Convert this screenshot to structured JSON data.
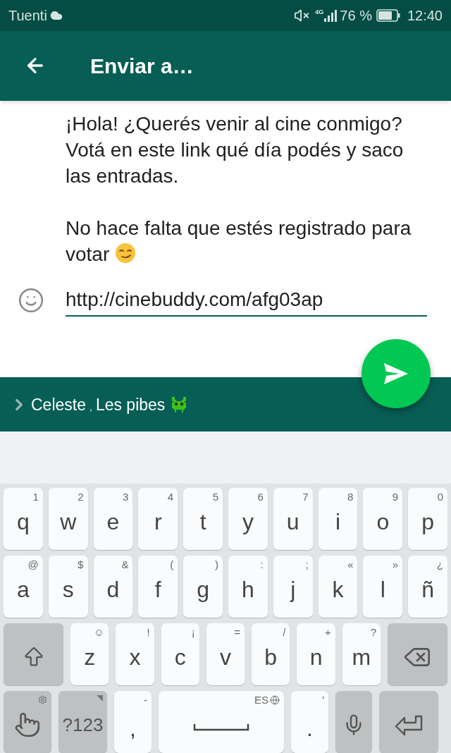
{
  "status_bar": {
    "carrier": "Tuenti",
    "network": "4G",
    "battery": "76 %",
    "time": "12:40"
  },
  "app_bar": {
    "title": "Enviar a…"
  },
  "message": {
    "paragraphs": [
      "¡Hola! ¿Querés venir al cine conmigo? Votá en este link qué día podés y saco las entradas.",
      "No hace falta que estés registrado para votar"
    ],
    "link_field": {
      "value": "http://cinebuddy.com/afg03ap"
    }
  },
  "recipients": {
    "items": [
      {
        "name": "Celeste"
      },
      {
        "name": "Les pibes"
      }
    ],
    "separator": ","
  },
  "keyboard": {
    "rows": [
      [
        {
          "kind": "letter",
          "label": "q",
          "hint": "1"
        },
        {
          "kind": "letter",
          "label": "w",
          "hint": "2"
        },
        {
          "kind": "letter",
          "label": "e",
          "hint": "3"
        },
        {
          "kind": "letter",
          "label": "r",
          "hint": "4"
        },
        {
          "kind": "letter",
          "label": "t",
          "hint": "5"
        },
        {
          "kind": "letter",
          "label": "y",
          "hint": "6"
        },
        {
          "kind": "letter",
          "label": "u",
          "hint": "7"
        },
        {
          "kind": "letter",
          "label": "i",
          "hint": "8"
        },
        {
          "kind": "letter",
          "label": "o",
          "hint": "9"
        },
        {
          "kind": "letter",
          "label": "p",
          "hint": "0"
        }
      ],
      [
        {
          "kind": "letter",
          "label": "a",
          "hint": "@"
        },
        {
          "kind": "letter",
          "label": "s",
          "hint": "$"
        },
        {
          "kind": "letter",
          "label": "d",
          "hint": "&"
        },
        {
          "kind": "letter",
          "label": "f",
          "hint": "("
        },
        {
          "kind": "letter",
          "label": "g",
          "hint": ")"
        },
        {
          "kind": "letter",
          "label": "h",
          "hint": ":"
        },
        {
          "kind": "letter",
          "label": "j",
          "hint": ";"
        },
        {
          "kind": "letter",
          "label": "k",
          "hint": "«"
        },
        {
          "kind": "letter",
          "label": "l",
          "hint": "»"
        },
        {
          "kind": "letter",
          "label": "ñ",
          "hint": "¿"
        }
      ],
      [
        {
          "kind": "shift"
        },
        {
          "kind": "letter",
          "label": "z",
          "hint": "☺"
        },
        {
          "kind": "letter",
          "label": "x",
          "hint": "!"
        },
        {
          "kind": "letter",
          "label": "c",
          "hint": "¡"
        },
        {
          "kind": "letter",
          "label": "v",
          "hint": "="
        },
        {
          "kind": "letter",
          "label": "b",
          "hint": "/"
        },
        {
          "kind": "letter",
          "label": "n",
          "hint": "+"
        },
        {
          "kind": "letter",
          "label": "m",
          "hint": "?"
        },
        {
          "kind": "backspace"
        }
      ],
      [
        {
          "kind": "gesture"
        },
        {
          "kind": "symbols",
          "label": "?123"
        },
        {
          "kind": "comma",
          "label": ",",
          "hint": "-"
        },
        {
          "kind": "space",
          "hint": "ES"
        },
        {
          "kind": "period",
          "label": ".",
          "hint": "'"
        },
        {
          "kind": "mic"
        },
        {
          "kind": "enter"
        }
      ]
    ]
  }
}
